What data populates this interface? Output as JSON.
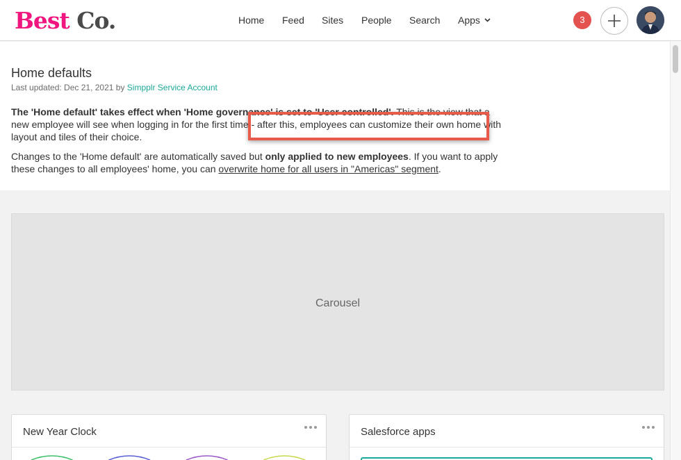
{
  "brand": {
    "logo_part1": "Best",
    "logo_part2": "Co.",
    "accent": "#f0157f",
    "link_color": "#1aa899",
    "highlight_color": "#e85a4a"
  },
  "nav": {
    "items": [
      {
        "label": "Home"
      },
      {
        "label": "Feed"
      },
      {
        "label": "Sites"
      },
      {
        "label": "People"
      },
      {
        "label": "Search"
      },
      {
        "label": "Apps"
      }
    ]
  },
  "header_right": {
    "notification_count": "3",
    "add_icon": "plus-icon",
    "avatar_icon": "user-avatar"
  },
  "page": {
    "title": "Home defaults",
    "updated_prefix": "Last updated: Dec 21, 2021 by",
    "updated_by": "Simpplr Service Account",
    "para1_bold": "The 'Home default' takes effect when 'Home governance' is set to 'User controlled'.",
    "para1_rest": " This is the view that a new employee will see when logging in for the first time - after this, employees can customize their own home with layout and tiles of their choice.",
    "para2_start": "Changes to the 'Home default' are automatically saved but ",
    "para2_bold": "only applied to new employees",
    "para2_mid": ". If you want to apply these changes to all employees' home, you can ",
    "para2_link": "overwrite home for all users in \"Americas\" segment",
    "para2_end": "."
  },
  "carousel": {
    "label": "Carousel"
  },
  "tiles": [
    {
      "title": "New Year Clock",
      "menu_icon": "more-horizontal-icon"
    },
    {
      "title": "Salesforce apps",
      "menu_icon": "more-horizontal-icon"
    }
  ]
}
